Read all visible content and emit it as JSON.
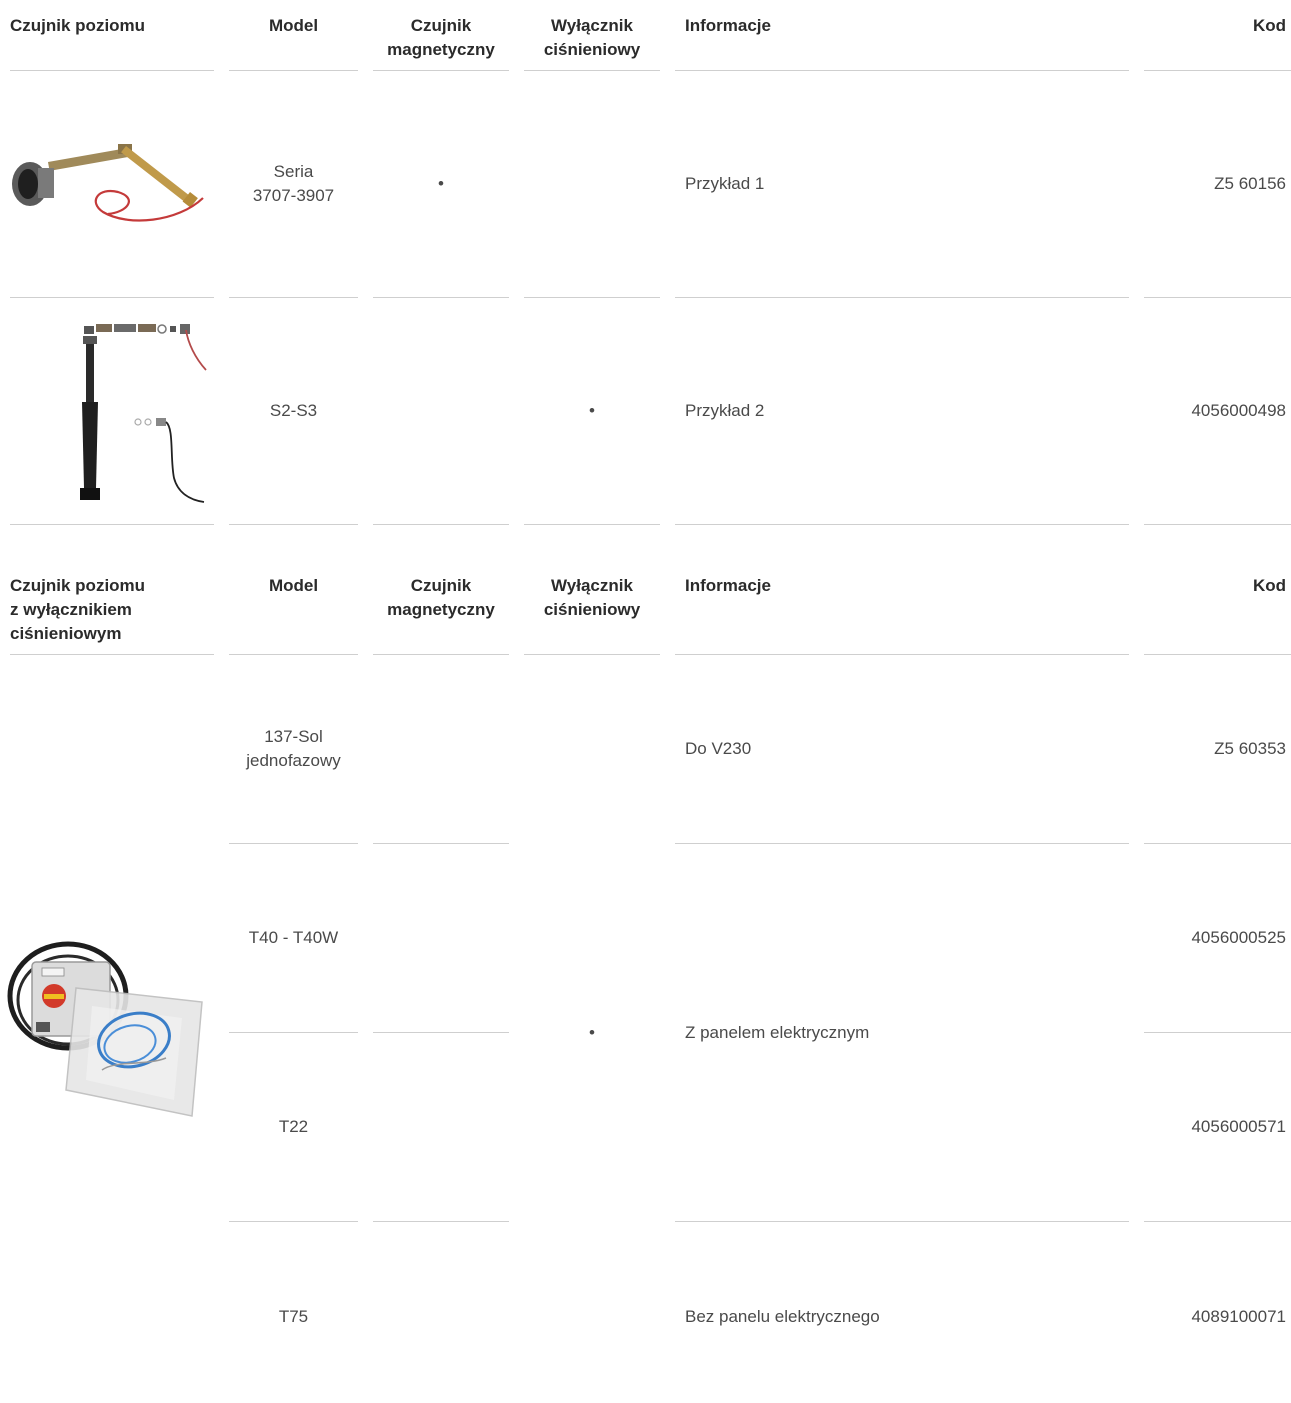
{
  "table1": {
    "headers": {
      "col1": "Czujnik poziomu",
      "model": "Model",
      "magnetic_line1": "Czujnik",
      "magnetic_line2": "magnetyczny",
      "pressure_line1": "Wyłącznik",
      "pressure_line2": "ciśnieniowy",
      "info": "Informacje",
      "code": "Kod"
    },
    "rows": [
      {
        "model_line1": "Seria",
        "model_line2": "3707-3907",
        "magnetic": "•",
        "pressure": "",
        "info": "Przykład 1",
        "code": "Z5 60156"
      },
      {
        "model_line1": "S2-S3",
        "model_line2": "",
        "magnetic": "",
        "pressure": "•",
        "info": "Przykład 2",
        "code": "4056000498"
      }
    ]
  },
  "table2": {
    "headers": {
      "col1_line1": "Czujnik poziomu",
      "col1_line2": "z wyłącznikiem",
      "col1_line3": "ciśnieniowym",
      "model": "Model",
      "magnetic_line1": "Czujnik",
      "magnetic_line2": "magnetyczny",
      "pressure_line1": "Wyłącznik",
      "pressure_line2": "ciśnieniowy",
      "info": "Informacje",
      "code": "Kod"
    },
    "pressure_mark": "•",
    "rows": [
      {
        "model_line1": "137-Sol",
        "model_line2": "jednofazowy",
        "info": "Do V230",
        "code": "Z5 60353"
      },
      {
        "model_line1": "T40 - T40W",
        "model_line2": "",
        "info": "",
        "code": "4056000525"
      },
      {
        "model_line1": "T22",
        "model_line2": "",
        "info": "",
        "code": "4056000571"
      },
      {
        "model_line1": "T75",
        "model_line2": "",
        "info": "Bez panelu elektrycznego",
        "code": "4089100071"
      }
    ],
    "merged_info": "Z panelem elektrycznym"
  },
  "colors": {
    "line": "#cfcfcf",
    "text": "#4a4a4a",
    "header": "#2b2b2b"
  }
}
